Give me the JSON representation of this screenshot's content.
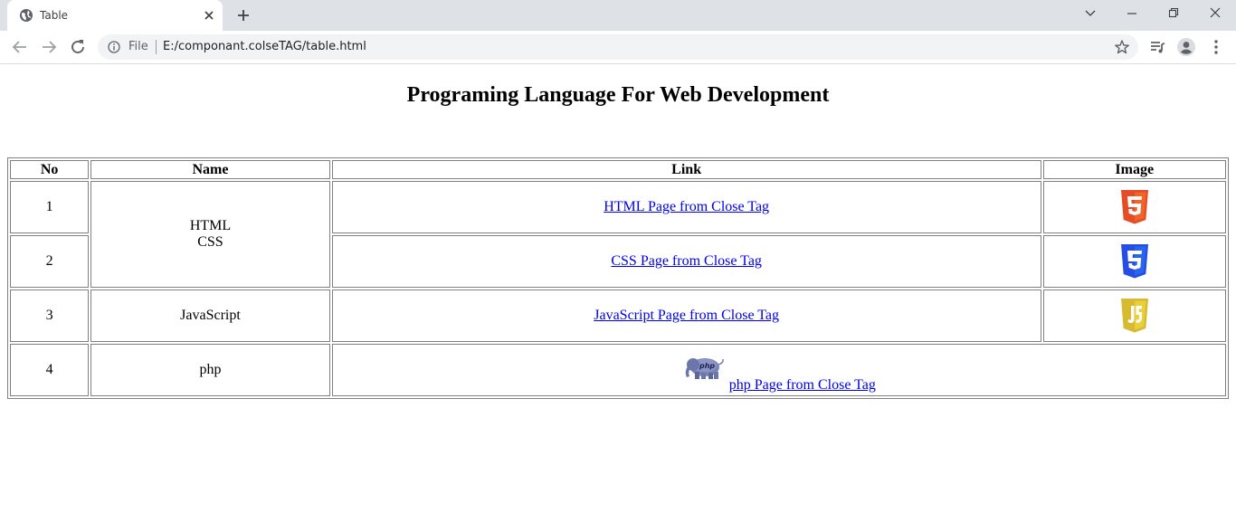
{
  "browser": {
    "tab": {
      "title": "Table"
    },
    "address": {
      "scheme_label": "File",
      "url": "E:/componant.colseTAG/table.html"
    }
  },
  "page": {
    "heading": "Programing Language For Web Development",
    "table": {
      "headers": [
        "No",
        "Name",
        "Link",
        "Image"
      ],
      "rows": [
        {
          "no": "1",
          "name_lines": [
            "HTML",
            "CSS"
          ],
          "link": "HTML Page from Close Tag",
          "image": "html5-logo-icon"
        },
        {
          "no": "2",
          "link": "CSS Page from Close Tag",
          "image": "css3-logo-icon"
        },
        {
          "no": "3",
          "name": "JavaScript",
          "link": "JavaScript Page from Close Tag",
          "image": "javascript-logo-icon"
        },
        {
          "no": "4",
          "name": "php",
          "link": "php Page from Close Tag",
          "image": "php-elephant-icon"
        }
      ]
    }
  },
  "colors": {
    "html_logo": "#e44d26",
    "css_logo": "#264de4",
    "js_logo": "#d6ba32",
    "link": "#0000ee"
  }
}
